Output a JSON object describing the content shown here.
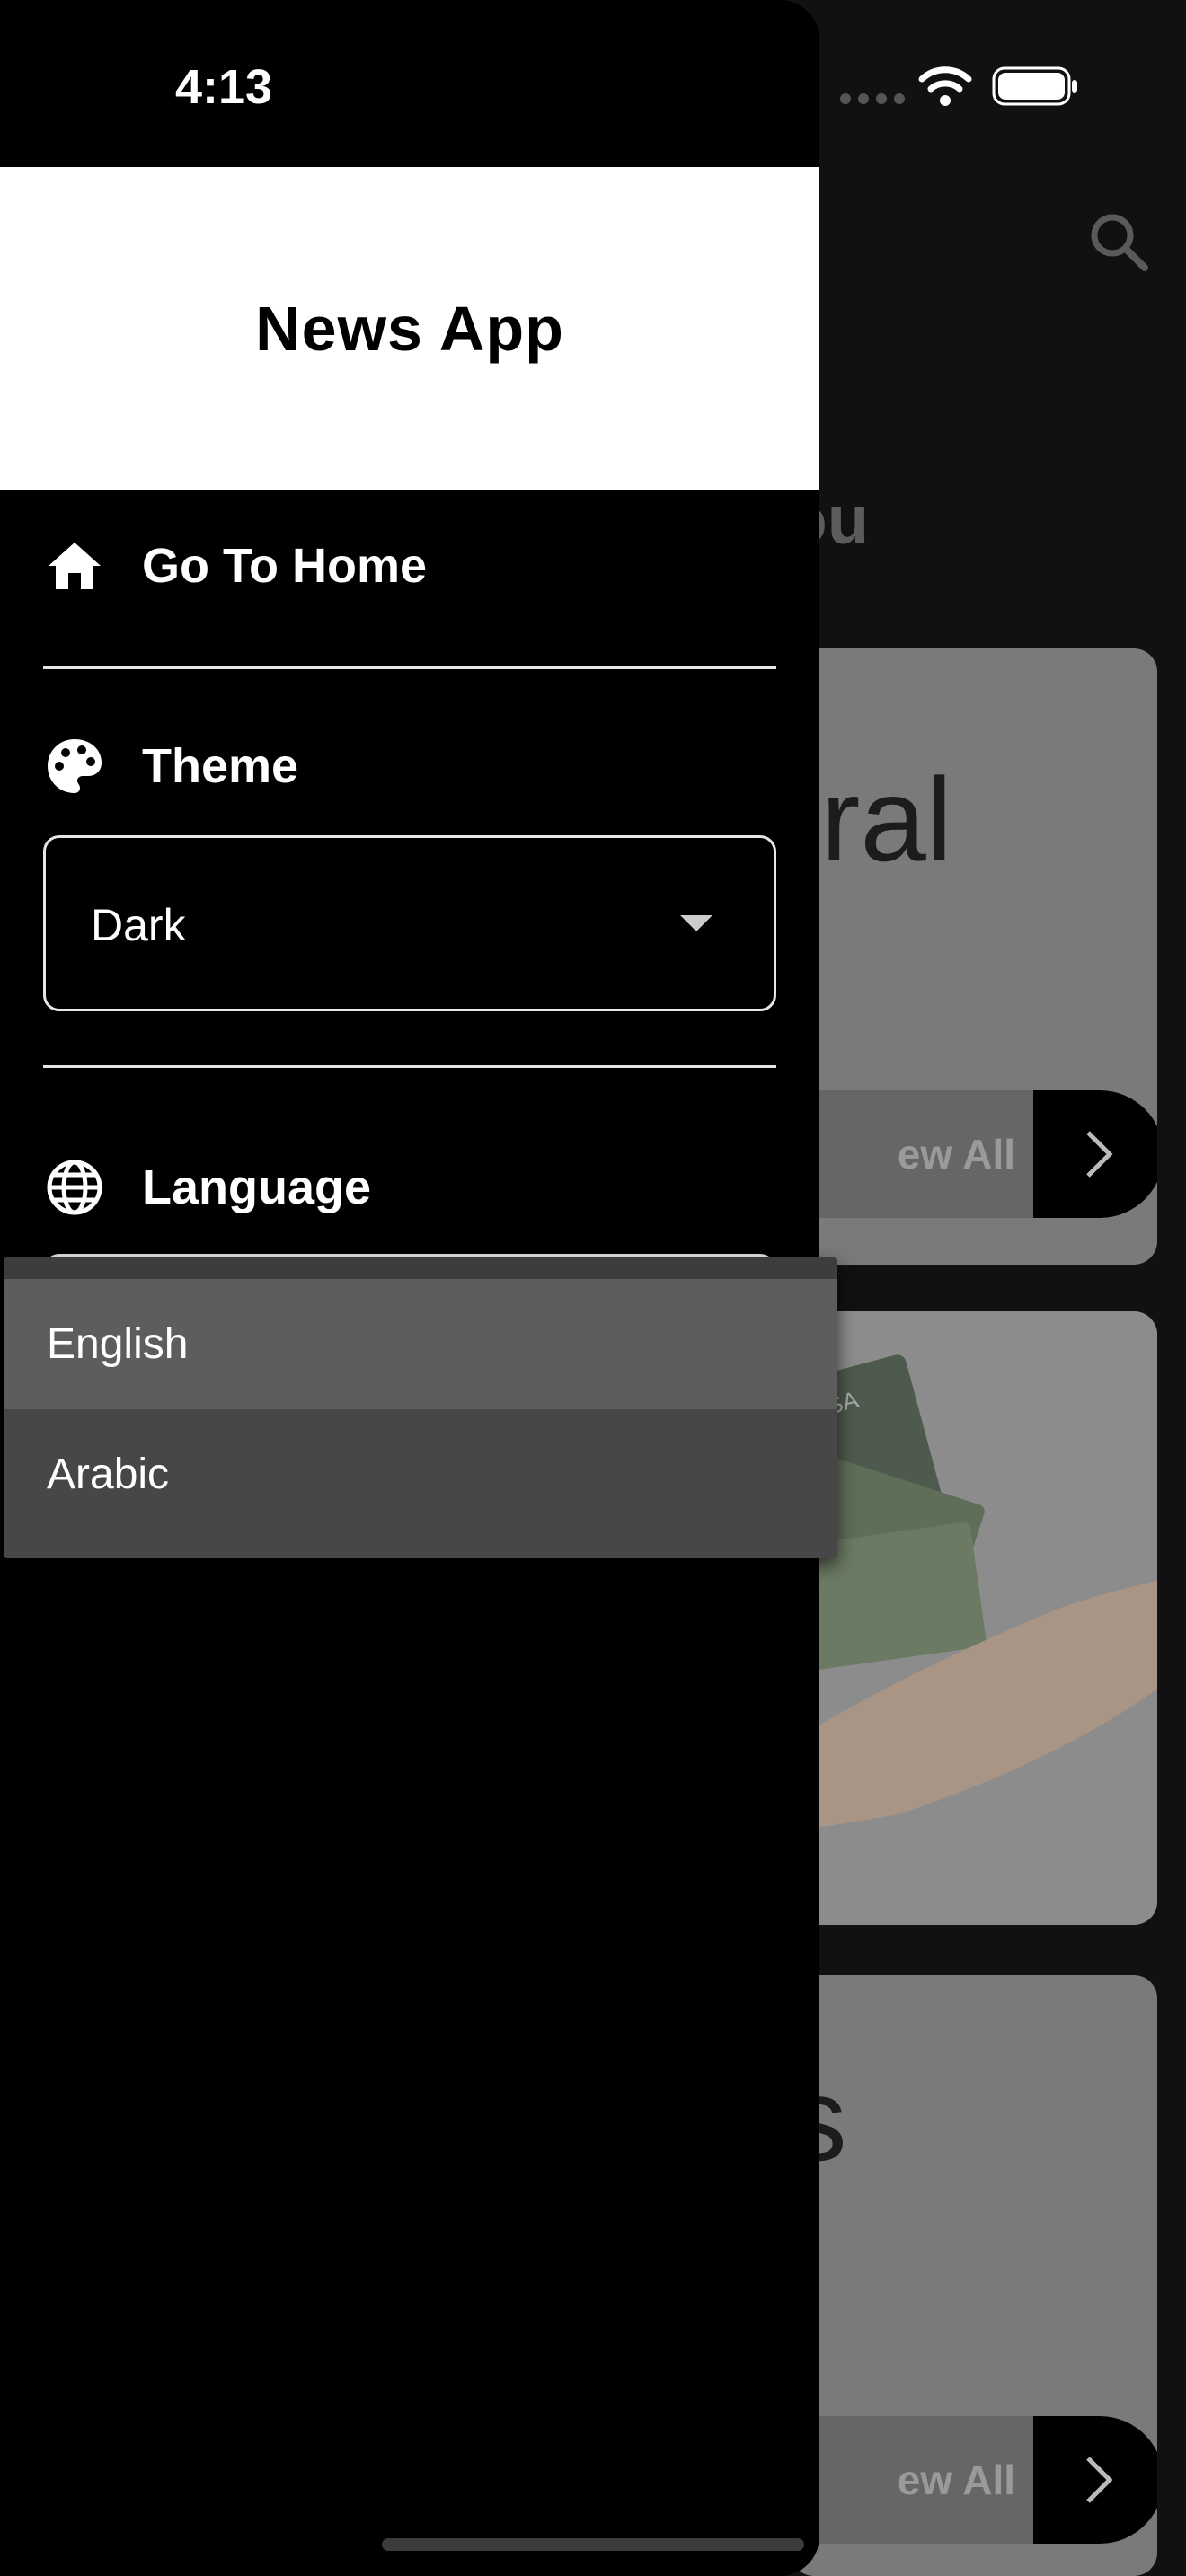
{
  "status_bar": {
    "time": "4:13"
  },
  "drawer": {
    "title": "News App",
    "home_label": "Go To Home",
    "theme_label": "Theme",
    "theme_value": "Dark",
    "language_label": "Language"
  },
  "language_dropdown": {
    "options": [
      "English",
      "Arabic"
    ],
    "selected": "English"
  },
  "background": {
    "heading": "r You",
    "cards": [
      {
        "title": "eral",
        "view_all": "ew All"
      },
      {
        "title": ""
      },
      {
        "title": "ts",
        "view_all": "ew All"
      }
    ]
  },
  "colors": {
    "drawer_bg": "#000000",
    "header_bg": "#ffffff",
    "dropdown_bg": "#474747",
    "dropdown_selected": "#5d5d5d",
    "card_bg": "#7a7a7a"
  }
}
